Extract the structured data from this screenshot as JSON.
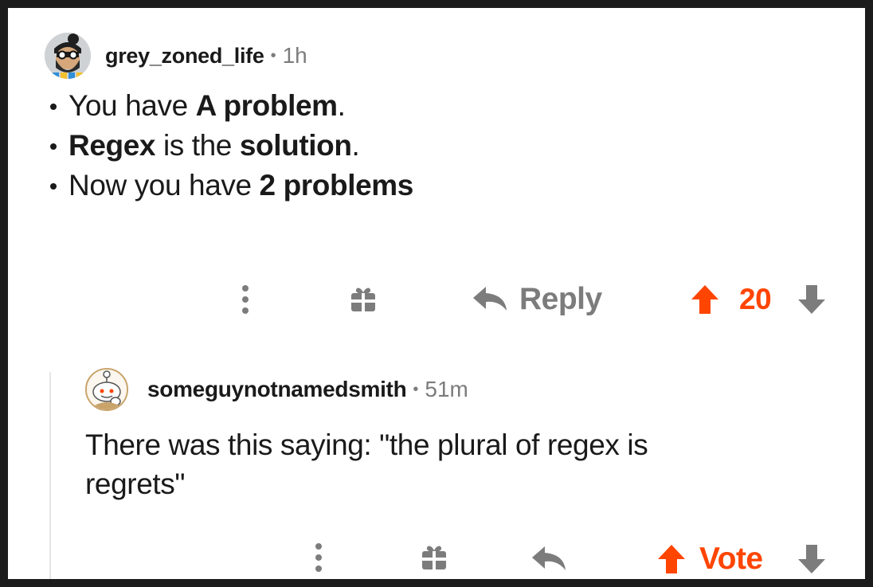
{
  "comment": {
    "username": "grey_zoned_life",
    "separator": "•",
    "time": "1h",
    "avatar_icon": "bearded-man-avatar",
    "bullets": [
      [
        {
          "t": "You have ",
          "b": false
        },
        {
          "t": "A problem",
          "b": true
        },
        {
          "t": ".",
          "b": false
        }
      ],
      [
        {
          "t": "Regex",
          "b": true
        },
        {
          "t": " is the ",
          "b": false
        },
        {
          "t": "solution",
          "b": true
        },
        {
          "t": ".",
          "b": false
        }
      ],
      [
        {
          "t": "Now you have ",
          "b": false
        },
        {
          "t": "2 problems",
          "b": true
        }
      ]
    ],
    "actions": {
      "more_icon": "more-vertical-icon",
      "award_icon": "gift-award-icon",
      "reply_icon": "reply-arrow-icon",
      "reply_label": "Reply",
      "upvote_icon": "upvote-arrow-icon",
      "score": "20",
      "downvote_icon": "downvote-arrow-icon"
    }
  },
  "reply": {
    "username": "someguynotnamedsmith",
    "separator": "•",
    "time": "51m",
    "avatar_icon": "snoo-avatar",
    "text": "There was this saying: \"the plural of regex is regrets\"",
    "actions": {
      "more_icon": "more-vertical-icon",
      "award_icon": "gift-award-icon",
      "reply_icon": "reply-arrow-icon",
      "upvote_icon": "upvote-arrow-icon",
      "vote_label": "Vote",
      "downvote_icon": "downvote-arrow-icon"
    }
  },
  "colors": {
    "upvote_active": "#ff4500",
    "icon_gray": "#7c7c7c",
    "text": "#1a1a1b"
  }
}
